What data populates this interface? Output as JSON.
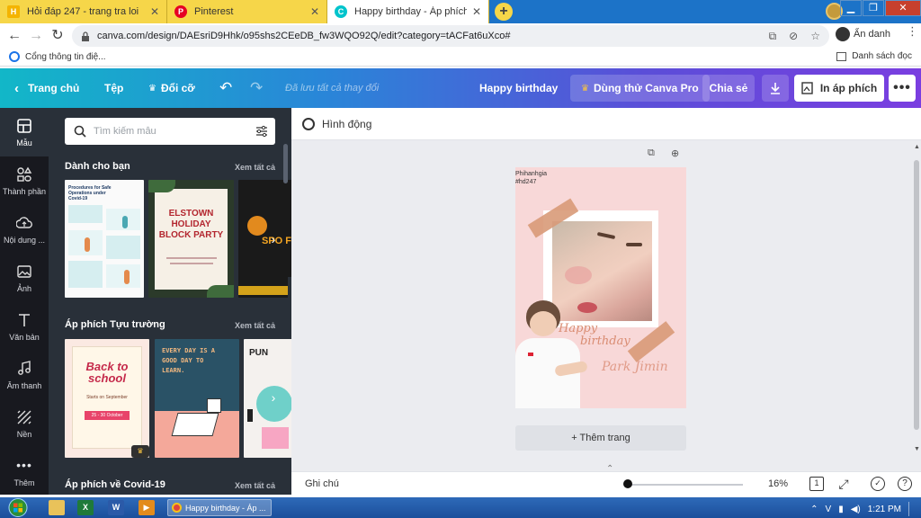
{
  "browser": {
    "tabs": [
      {
        "favicon": "H",
        "favicon_color": "#f4b400",
        "title": "Hỏi đáp 247 - trang tra loi",
        "active": false
      },
      {
        "favicon": "P",
        "favicon_color": "#e60023",
        "title": "Pinterest",
        "active": false
      },
      {
        "favicon": "C",
        "favicon_color": "#00c4cc",
        "title": "Happy birthday - Áp phích",
        "active": true
      }
    ],
    "url": "canva.com/design/DAEsriD9Hhk/o95shs2CEeDB_fw3WQO92Q/edit?category=tACFat6uXco#",
    "incognito_label": "Ẩn danh",
    "bookmark_left": "Cổng thông tin điệ...",
    "bookmark_right": "Danh sách đọc"
  },
  "canva_bar": {
    "home": "Trang chủ",
    "file": "Tệp",
    "resize": "Đổi cỡ",
    "saved": "Đã lưu tất cả thay đổi",
    "design_title": "Happy birthday",
    "try_pro": "Dùng thử Canva Pro",
    "share": "Chia sẻ",
    "print": "In áp phích"
  },
  "rail": [
    {
      "label": "Mẫu",
      "icon": "template-icon",
      "active": true
    },
    {
      "label": "Thành phần",
      "icon": "elements-icon",
      "active": false
    },
    {
      "label": "Nội dung ...",
      "icon": "upload-cloud-icon",
      "active": false
    },
    {
      "label": "Ảnh",
      "icon": "photo-icon",
      "active": false
    },
    {
      "label": "Văn bản",
      "icon": "text-icon",
      "active": false
    },
    {
      "label": "Âm thanh",
      "icon": "music-icon",
      "active": false
    },
    {
      "label": "Nền",
      "icon": "background-icon",
      "active": false
    },
    {
      "label": "Thêm",
      "icon": "more-icon",
      "active": false
    }
  ],
  "panel": {
    "search_placeholder": "Tìm kiếm mẫu",
    "sections": [
      {
        "title": "Dành cho bạn",
        "see_all": "Xem tất cả"
      },
      {
        "title": "Áp phích Tựu trường",
        "see_all": "Xem tất cả"
      },
      {
        "title": "Áp phích về Covid-19",
        "see_all": "Xem tất cả"
      }
    ],
    "thumbs_row1": {
      "covid_title": "Procedures for Safe Operations under Covid-19",
      "holiday": "ELSTOWN HOLIDAY BLOCK PARTY",
      "spooky": "SPO FI"
    },
    "thumbs_row2": {
      "school_title": "Back to school",
      "school_sub": "Starts on September",
      "school_date": "25 - 30 October",
      "everyday": "EVERY DAY IS A GOOD DAY TO LEARN.",
      "pun": "PUN"
    }
  },
  "workspace": {
    "animate": "Hình động",
    "poster": {
      "tag_line1": "Phihanhgia",
      "tag_line2": "#hd247",
      "script1": "Happy",
      "script2": "birthday",
      "name": "Park Jimin"
    },
    "add_page": "+ Thêm trang"
  },
  "bottom": {
    "notes": "Ghi chú",
    "zoom": "16%",
    "page_count": "1"
  },
  "taskbar": {
    "window_title": "Happy birthday - Áp ...",
    "app_x": "X",
    "app_w": "W",
    "lang": "V",
    "time": "1:21 PM"
  },
  "colors": {
    "canva_gradient_start": "#12b7c8",
    "canva_gradient_end": "#7a3ee0",
    "panel": "#293039",
    "rail": "#18191f",
    "poster_bg": "#f8d8d8",
    "tab_yellow": "#f6d649"
  }
}
